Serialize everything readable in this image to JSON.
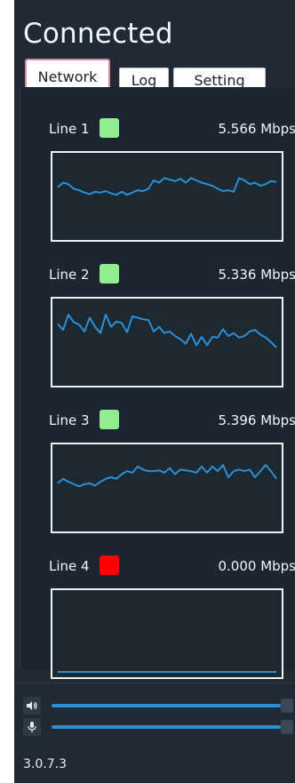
{
  "status_title": "Connected",
  "tabs": [
    {
      "label": "Network",
      "active": true
    },
    {
      "label": "Log",
      "active": false
    },
    {
      "label": "Setting",
      "active": false
    }
  ],
  "lines": [
    {
      "label": "Line 1",
      "rate": "5.566 Mbps",
      "status_color": "#90ee90",
      "traffic": [
        0.62,
        0.68,
        0.66,
        0.6,
        0.58,
        0.55,
        0.53,
        0.56,
        0.55,
        0.57,
        0.54,
        0.52,
        0.56,
        0.52,
        0.55,
        0.58,
        0.57,
        0.6,
        0.71,
        0.68,
        0.74,
        0.72,
        0.7,
        0.73,
        0.68,
        0.74,
        0.71,
        0.68,
        0.66,
        0.64,
        0.6,
        0.57,
        0.58,
        0.56,
        0.74,
        0.71,
        0.66,
        0.68,
        0.64,
        0.66,
        0.7,
        0.69
      ]
    },
    {
      "label": "Line 2",
      "rate": "5.336 Mbps",
      "status_color": "#90ee90",
      "traffic": [
        0.74,
        0.66,
        0.86,
        0.76,
        0.73,
        0.64,
        0.82,
        0.7,
        0.62,
        0.86,
        0.7,
        0.77,
        0.75,
        0.63,
        0.84,
        0.82,
        0.8,
        0.79,
        0.64,
        0.7,
        0.62,
        0.64,
        0.58,
        0.54,
        0.48,
        0.61,
        0.46,
        0.57,
        0.46,
        0.57,
        0.56,
        0.67,
        0.58,
        0.62,
        0.56,
        0.58,
        0.64,
        0.66,
        0.6,
        0.56,
        0.5,
        0.43
      ]
    },
    {
      "label": "Line 3",
      "rate": "5.396 Mbps",
      "status_color": "#90ee90",
      "traffic": [
        0.56,
        0.62,
        0.58,
        0.55,
        0.52,
        0.55,
        0.56,
        0.53,
        0.58,
        0.62,
        0.64,
        0.62,
        0.68,
        0.72,
        0.7,
        0.78,
        0.74,
        0.72,
        0.72,
        0.73,
        0.7,
        0.76,
        0.68,
        0.74,
        0.73,
        0.72,
        0.7,
        0.78,
        0.7,
        0.78,
        0.72,
        0.8,
        0.64,
        0.72,
        0.74,
        0.72,
        0.74,
        0.64,
        0.72,
        0.8,
        0.72,
        0.62
      ]
    },
    {
      "label": "Line 4",
      "rate": "0.000 Mbps",
      "status_color": "#ff0000",
      "traffic": [
        0,
        0,
        0,
        0,
        0,
        0,
        0,
        0,
        0,
        0,
        0,
        0,
        0,
        0,
        0,
        0,
        0,
        0,
        0,
        0,
        0,
        0,
        0,
        0,
        0,
        0,
        0,
        0,
        0,
        0,
        0,
        0,
        0,
        0,
        0,
        0,
        0,
        0,
        0,
        0,
        0,
        0
      ]
    }
  ],
  "controls": {
    "speaker_icon": "speaker-icon",
    "mic_icon": "microphone-icon",
    "speaker_level": 0.99,
    "mic_level": 0.99
  },
  "version": "3.0.7.3",
  "colors": {
    "accent": "#2b8fd6",
    "panel": "#1f2a34"
  }
}
